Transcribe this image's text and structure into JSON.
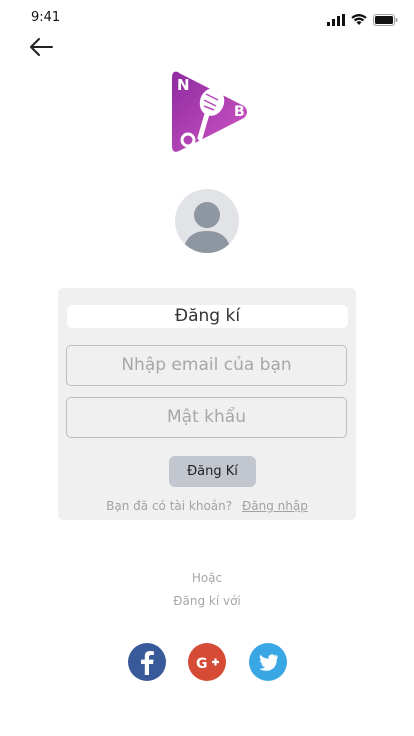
{
  "status_bar": {
    "time": "9:41"
  },
  "logo": {
    "letters": [
      "N",
      "B",
      "O"
    ],
    "colors": {
      "left": "#9b2ea3",
      "right": "#c54cc2",
      "mic": "#ffffff"
    }
  },
  "form": {
    "title": "Đăng kí",
    "email_placeholder": "Nhập email của bạn",
    "password_placeholder": "Mật khẩu",
    "submit_label": "Đăng Kí",
    "have_account_text": "Bạn đã có tài khoản?",
    "login_link": "Đăng nhập"
  },
  "alt": {
    "or_text": "Hoặc",
    "register_with_text": "Đăng kí với"
  },
  "social": [
    {
      "name": "facebook",
      "icon": "facebook-icon",
      "color": "#385a9a"
    },
    {
      "name": "google-plus",
      "icon": "google-plus-icon",
      "color": "#d64b35"
    },
    {
      "name": "twitter",
      "icon": "twitter-icon",
      "color": "#3aa7e5"
    }
  ]
}
